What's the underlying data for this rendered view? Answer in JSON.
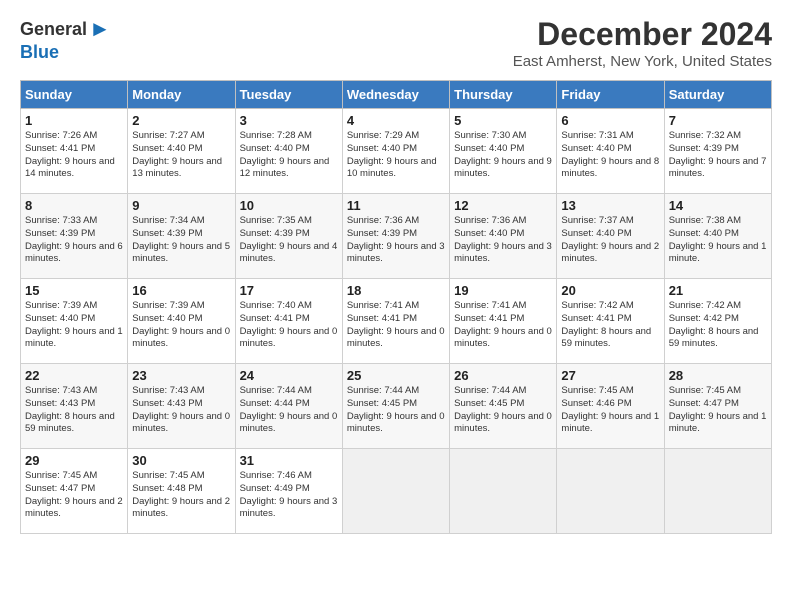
{
  "header": {
    "logo_general": "General",
    "logo_blue": "Blue",
    "month_title": "December 2024",
    "location": "East Amherst, New York, United States"
  },
  "calendar": {
    "days_of_week": [
      "Sunday",
      "Monday",
      "Tuesday",
      "Wednesday",
      "Thursday",
      "Friday",
      "Saturday"
    ],
    "weeks": [
      [
        {
          "day": "1",
          "sunrise": "7:26 AM",
          "sunset": "4:41 PM",
          "daylight": "9 hours and 14 minutes."
        },
        {
          "day": "2",
          "sunrise": "7:27 AM",
          "sunset": "4:40 PM",
          "daylight": "9 hours and 13 minutes."
        },
        {
          "day": "3",
          "sunrise": "7:28 AM",
          "sunset": "4:40 PM",
          "daylight": "9 hours and 12 minutes."
        },
        {
          "day": "4",
          "sunrise": "7:29 AM",
          "sunset": "4:40 PM",
          "daylight": "9 hours and 10 minutes."
        },
        {
          "day": "5",
          "sunrise": "7:30 AM",
          "sunset": "4:40 PM",
          "daylight": "9 hours and 9 minutes."
        },
        {
          "day": "6",
          "sunrise": "7:31 AM",
          "sunset": "4:40 PM",
          "daylight": "9 hours and 8 minutes."
        },
        {
          "day": "7",
          "sunrise": "7:32 AM",
          "sunset": "4:39 PM",
          "daylight": "9 hours and 7 minutes."
        }
      ],
      [
        {
          "day": "8",
          "sunrise": "7:33 AM",
          "sunset": "4:39 PM",
          "daylight": "9 hours and 6 minutes."
        },
        {
          "day": "9",
          "sunrise": "7:34 AM",
          "sunset": "4:39 PM",
          "daylight": "9 hours and 5 minutes."
        },
        {
          "day": "10",
          "sunrise": "7:35 AM",
          "sunset": "4:39 PM",
          "daylight": "9 hours and 4 minutes."
        },
        {
          "day": "11",
          "sunrise": "7:36 AM",
          "sunset": "4:39 PM",
          "daylight": "9 hours and 3 minutes."
        },
        {
          "day": "12",
          "sunrise": "7:36 AM",
          "sunset": "4:40 PM",
          "daylight": "9 hours and 3 minutes."
        },
        {
          "day": "13",
          "sunrise": "7:37 AM",
          "sunset": "4:40 PM",
          "daylight": "9 hours and 2 minutes."
        },
        {
          "day": "14",
          "sunrise": "7:38 AM",
          "sunset": "4:40 PM",
          "daylight": "9 hours and 1 minute."
        }
      ],
      [
        {
          "day": "15",
          "sunrise": "7:39 AM",
          "sunset": "4:40 PM",
          "daylight": "9 hours and 1 minute."
        },
        {
          "day": "16",
          "sunrise": "7:39 AM",
          "sunset": "4:40 PM",
          "daylight": "9 hours and 0 minutes."
        },
        {
          "day": "17",
          "sunrise": "7:40 AM",
          "sunset": "4:41 PM",
          "daylight": "9 hours and 0 minutes."
        },
        {
          "day": "18",
          "sunrise": "7:41 AM",
          "sunset": "4:41 PM",
          "daylight": "9 hours and 0 minutes."
        },
        {
          "day": "19",
          "sunrise": "7:41 AM",
          "sunset": "4:41 PM",
          "daylight": "9 hours and 0 minutes."
        },
        {
          "day": "20",
          "sunrise": "7:42 AM",
          "sunset": "4:41 PM",
          "daylight": "8 hours and 59 minutes."
        },
        {
          "day": "21",
          "sunrise": "7:42 AM",
          "sunset": "4:42 PM",
          "daylight": "8 hours and 59 minutes."
        }
      ],
      [
        {
          "day": "22",
          "sunrise": "7:43 AM",
          "sunset": "4:43 PM",
          "daylight": "8 hours and 59 minutes."
        },
        {
          "day": "23",
          "sunrise": "7:43 AM",
          "sunset": "4:43 PM",
          "daylight": "9 hours and 0 minutes."
        },
        {
          "day": "24",
          "sunrise": "7:44 AM",
          "sunset": "4:44 PM",
          "daylight": "9 hours and 0 minutes."
        },
        {
          "day": "25",
          "sunrise": "7:44 AM",
          "sunset": "4:45 PM",
          "daylight": "9 hours and 0 minutes."
        },
        {
          "day": "26",
          "sunrise": "7:44 AM",
          "sunset": "4:45 PM",
          "daylight": "9 hours and 0 minutes."
        },
        {
          "day": "27",
          "sunrise": "7:45 AM",
          "sunset": "4:46 PM",
          "daylight": "9 hours and 1 minute."
        },
        {
          "day": "28",
          "sunrise": "7:45 AM",
          "sunset": "4:47 PM",
          "daylight": "9 hours and 1 minute."
        }
      ],
      [
        {
          "day": "29",
          "sunrise": "7:45 AM",
          "sunset": "4:47 PM",
          "daylight": "9 hours and 2 minutes."
        },
        {
          "day": "30",
          "sunrise": "7:45 AM",
          "sunset": "4:48 PM",
          "daylight": "9 hours and 2 minutes."
        },
        {
          "day": "31",
          "sunrise": "7:46 AM",
          "sunset": "4:49 PM",
          "daylight": "9 hours and 3 minutes."
        },
        null,
        null,
        null,
        null
      ]
    ]
  }
}
